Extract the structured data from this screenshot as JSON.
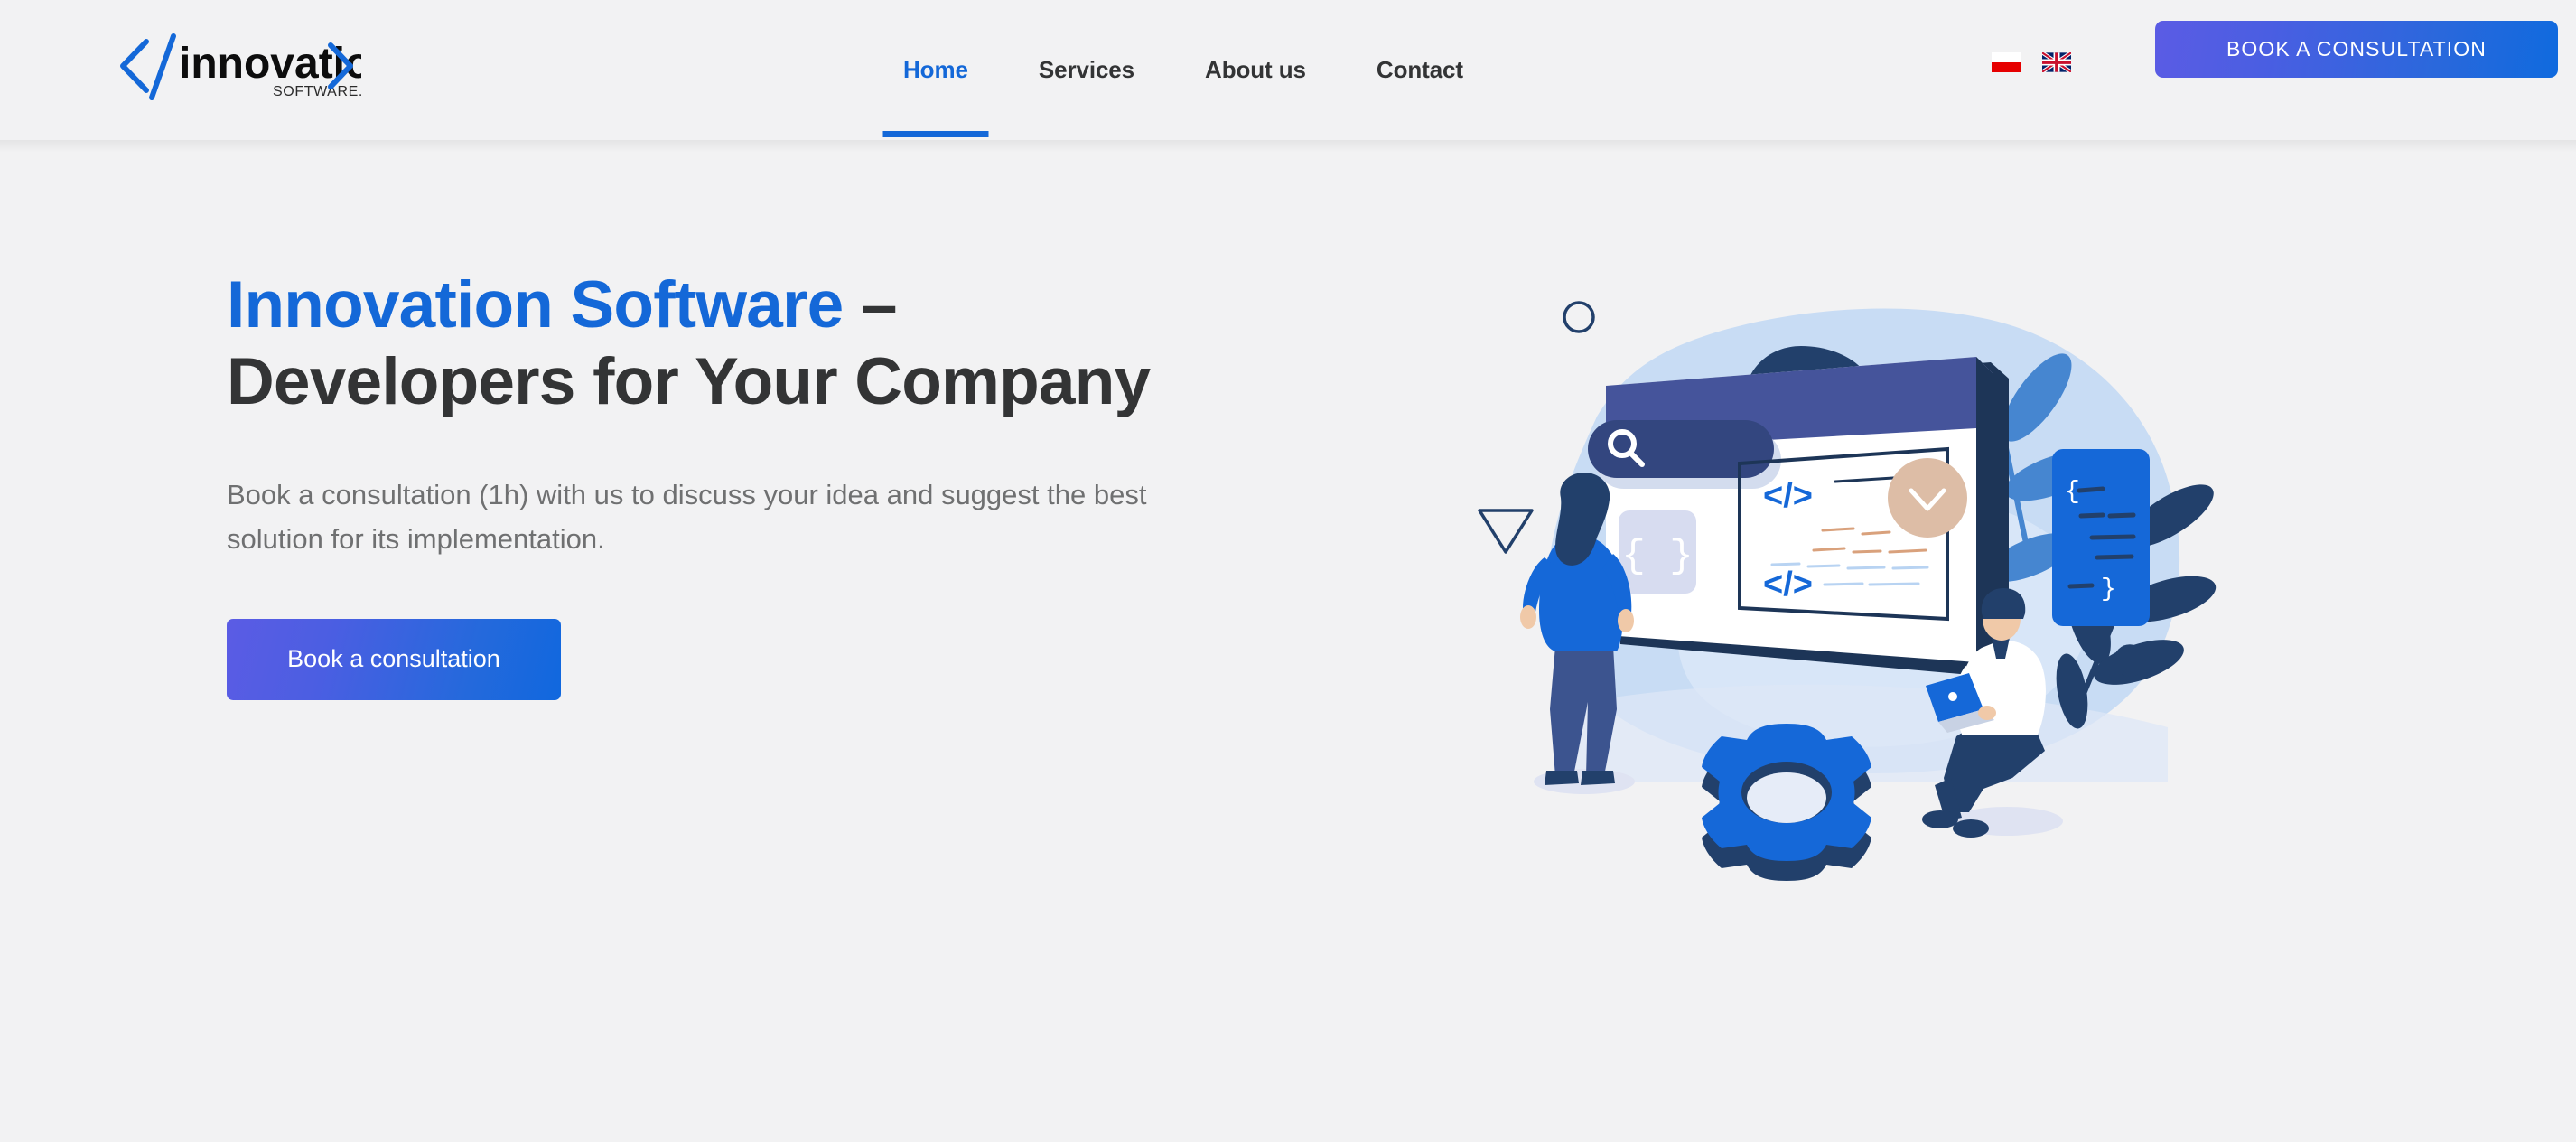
{
  "header": {
    "logo": {
      "name": "innovation",
      "tagline": "SOFTWARE.",
      "bracket_open": "</",
      "bracket_close": ">"
    },
    "nav": [
      {
        "label": "Home",
        "active": true
      },
      {
        "label": "Services",
        "active": false
      },
      {
        "label": "About us",
        "active": false
      },
      {
        "label": "Contact",
        "active": false
      }
    ],
    "languages": [
      {
        "code": "pl",
        "name": "polish-flag-icon"
      },
      {
        "code": "en",
        "name": "english-flag-icon"
      }
    ],
    "cta_label": "BOOK A CONSULTATION"
  },
  "hero": {
    "title_brand": "Innovation Software",
    "title_dash": " – ",
    "title_rest": "Developers for Your Company",
    "subtitle": "Book a consultation (1h) with us to discuss your idea and suggest the best solution for its implementation.",
    "cta_label": "Book a consultation",
    "illustration_name": "developers-coding-illustration",
    "illustration_symbols": {
      "code_tag_top": "</>",
      "code_tag_bottom": "</>",
      "braces": "{ }",
      "snippet_open": "{",
      "snippet_close": "}"
    }
  },
  "colors": {
    "accent_blue": "#1468d8",
    "text_dark": "#333435",
    "text_muted": "#6f7071",
    "page_bg": "#f2f2f3",
    "gradient_start": "#5b5ce4",
    "gradient_end": "#0f6ade",
    "illustration_navy": "#22406b",
    "illustration_blue": "#1568d8",
    "illustration_light_blue": "#c3d8f2"
  }
}
